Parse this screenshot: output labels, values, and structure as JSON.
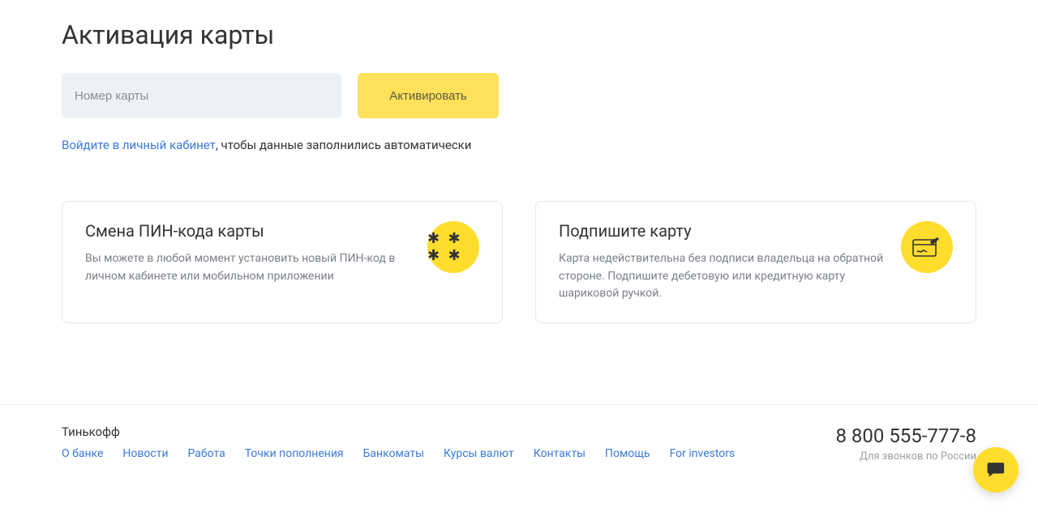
{
  "page": {
    "title": "Активация карты"
  },
  "form": {
    "card_placeholder": "Номер карты",
    "activate_label": "Активировать"
  },
  "hint": {
    "login_link": "Войдите в личный кабинет",
    "suffix": ", чтобы данные заполнились автоматически"
  },
  "cards": {
    "pin": {
      "title": "Смена ПИН-кода карты",
      "desc": "Вы можете в любой момент установить новый ПИН-код в личном кабинете или мобильном приложении",
      "icon_glyph": "✱ ✱ ✱ ✱"
    },
    "sign": {
      "title": "Подпишите карту",
      "desc": "Карта недействительна без подписи владельца на обратной стороне. Подпишите дебетовую или кредитную карту шариковой ручкой."
    }
  },
  "footer": {
    "brand": "Тинькофф",
    "links": [
      "О банке",
      "Новости",
      "Работа",
      "Точки пополнения",
      "Банкоматы",
      "Курсы валют",
      "Контакты",
      "Помощь",
      "For investors"
    ],
    "phone": "8 800 555-777-8",
    "phone_hint": "Для звонков по России"
  }
}
